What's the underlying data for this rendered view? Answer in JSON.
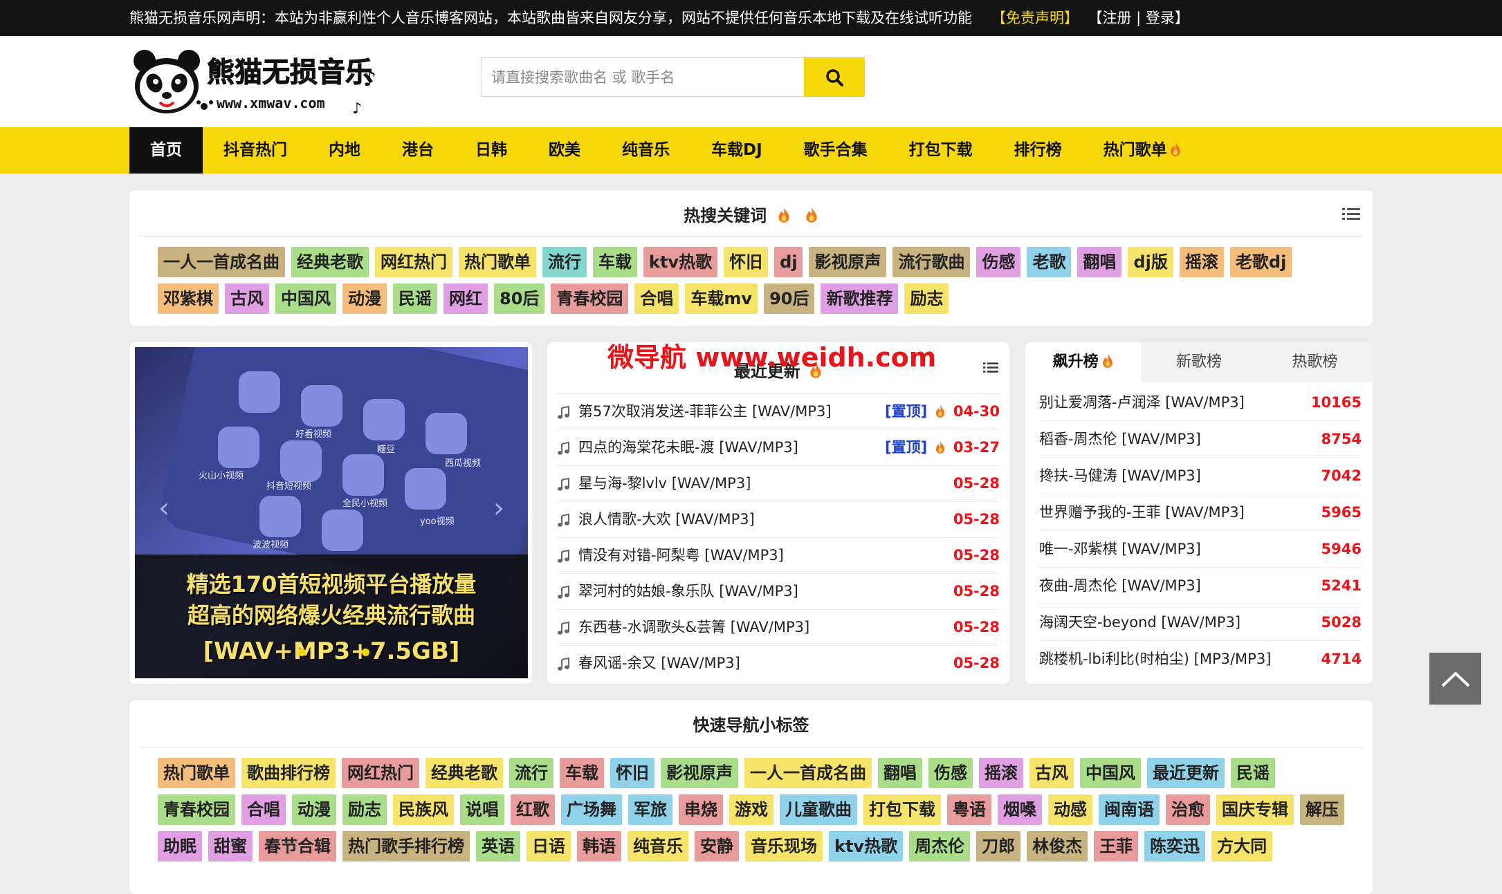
{
  "topbar": {
    "notice": "熊猫无损音乐网声明：本站为非赢利性个人音乐博客网站，本站歌曲皆来自网友分享，网站不提供任何音乐本地下载及在线试听功能",
    "disclaimer": "【免责声明】",
    "account": "【注册 | 登录】"
  },
  "logo": {
    "title": "熊猫无损音乐",
    "url": "www.xmwav.com"
  },
  "search": {
    "placeholder": "请直接搜索歌曲名 或 歌手名",
    "value": ""
  },
  "nav": [
    "首页",
    "抖音热门",
    "内地",
    "港台",
    "日韩",
    "欧美",
    "纯音乐",
    "车载DJ",
    "歌手合集",
    "打包下载",
    "排行榜",
    "热门歌单"
  ],
  "hot_keywords": {
    "title": "热搜关键词",
    "tags": [
      {
        "text": "一人一首成名曲",
        "color": "#c8b27f"
      },
      {
        "text": "经典老歌",
        "color": "#a9dd8a"
      },
      {
        "text": "网红热门",
        "color": "#f6e46a"
      },
      {
        "text": "热门歌单",
        "color": "#f6e46a"
      },
      {
        "text": "流行",
        "color": "#85d8cf"
      },
      {
        "text": "车载",
        "color": "#a9dd8a"
      },
      {
        "text": "ktv热歌",
        "color": "#e89b9b"
      },
      {
        "text": "怀旧",
        "color": "#f6e46a"
      },
      {
        "text": "dj",
        "color": "#e89b9b"
      },
      {
        "text": "影视原声",
        "color": "#c8b27f"
      },
      {
        "text": "流行歌曲",
        "color": "#c8b27f"
      },
      {
        "text": "伤感",
        "color": "#df9fe2"
      },
      {
        "text": "老歌",
        "color": "#8fd2ea"
      },
      {
        "text": "翻唱",
        "color": "#df9fe2"
      },
      {
        "text": "dj版",
        "color": "#f6e46a"
      },
      {
        "text": "摇滚",
        "color": "#f4bd7c"
      },
      {
        "text": "老歌dj",
        "color": "#f4bd7c"
      },
      {
        "text": "邓紫棋",
        "color": "#f4bd7c"
      },
      {
        "text": "古风",
        "color": "#df9fe2"
      },
      {
        "text": "中国风",
        "color": "#a9dd8a"
      },
      {
        "text": "动漫",
        "color": "#f4bd7c"
      },
      {
        "text": "民谣",
        "color": "#a9dd8a"
      },
      {
        "text": "网红",
        "color": "#df9fe2"
      },
      {
        "text": "80后",
        "color": "#a9dd8a"
      },
      {
        "text": "青春校园",
        "color": "#e89b9b"
      },
      {
        "text": "合唱",
        "color": "#f6e46a"
      },
      {
        "text": "车载mv",
        "color": "#f6e46a"
      },
      {
        "text": "90后",
        "color": "#c8b27f"
      },
      {
        "text": "新歌推荐",
        "color": "#df9fe2"
      },
      {
        "text": "励志",
        "color": "#f6e46a"
      }
    ]
  },
  "banner": {
    "caption1": "精选170首短视频平台播放量",
    "caption2": "超高的网络爆火经典流行歌曲",
    "caption3": "[WAV+MP3+7.5GB]",
    "app_labels": [
      "抖音短视频",
      "火山小视频",
      "好看视频",
      "全民小视频",
      "西瓜视频",
      "yoo视频",
      "糖豆",
      "波波视频"
    ]
  },
  "watermark": "微导航 www.weidh.com",
  "recent": {
    "title": "最近更新",
    "items": [
      {
        "song": "第57次取消发送-菲菲公主 [WAV/MP3]",
        "sticky": "[置顶]",
        "date": "04-30"
      },
      {
        "song": "四点的海棠花未眠-渡 [WAV/MP3]",
        "sticky": "[置顶]",
        "date": "03-27"
      },
      {
        "song": "星与海-黎lvlv [WAV/MP3]",
        "date": "05-28"
      },
      {
        "song": "浪人情歌-大欢 [WAV/MP3]",
        "date": "05-28"
      },
      {
        "song": "情没有对错-阿梨粤 [WAV/MP3]",
        "date": "05-28"
      },
      {
        "song": "翠河村的姑娘-象乐队 [WAV/MP3]",
        "date": "05-28"
      },
      {
        "song": "东西巷-水调歌头&芸箐 [WAV/MP3]",
        "date": "05-28"
      },
      {
        "song": "春风谣-余又 [WAV/MP3]",
        "date": "05-28"
      }
    ]
  },
  "charts": {
    "tabs": [
      "飙升榜",
      "新歌榜",
      "热歌榜"
    ],
    "items": [
      {
        "song": "别让爱凋落-卢润泽 [WAV/MP3]",
        "count": "10165"
      },
      {
        "song": "稻香-周杰伦 [WAV/MP3]",
        "count": "8754"
      },
      {
        "song": "搀扶-马健涛 [WAV/MP3]",
        "count": "7042"
      },
      {
        "song": "世界赠予我的-王菲 [WAV/MP3]",
        "count": "5965"
      },
      {
        "song": "唯一-邓紫棋 [WAV/MP3]",
        "count": "5946"
      },
      {
        "song": "夜曲-周杰伦 [WAV/MP3]",
        "count": "5241"
      },
      {
        "song": "海阔天空-beyond [WAV/MP3]",
        "count": "5028"
      },
      {
        "song": "跳楼机-lbi利比(时柏尘) [MP3/MP3]",
        "count": "4714"
      }
    ]
  },
  "quick_nav": {
    "title": "快速导航小标签",
    "tags": [
      {
        "text": "热门歌单",
        "color": "#f4bd7c"
      },
      {
        "text": "歌曲排行榜",
        "color": "#f6e46a"
      },
      {
        "text": "网红热门",
        "color": "#e89b9b"
      },
      {
        "text": "经典老歌",
        "color": "#f6e46a"
      },
      {
        "text": "流行",
        "color": "#a9dd8a"
      },
      {
        "text": "车载",
        "color": "#e89b9b"
      },
      {
        "text": "怀旧",
        "color": "#8fd2ea"
      },
      {
        "text": "影视原声",
        "color": "#a9dd8a"
      },
      {
        "text": "一人一首成名曲",
        "color": "#f6e46a"
      },
      {
        "text": "翻唱",
        "color": "#a9dd8a"
      },
      {
        "text": "伤感",
        "color": "#a9dd8a"
      },
      {
        "text": "摇滚",
        "color": "#df9fe2"
      },
      {
        "text": "古风",
        "color": "#f6e46a"
      },
      {
        "text": "中国风",
        "color": "#a9dd8a"
      },
      {
        "text": "最近更新",
        "color": "#8fd2ea"
      },
      {
        "text": "民谣",
        "color": "#a9dd8a"
      },
      {
        "text": "青春校园",
        "color": "#a9dd8a"
      },
      {
        "text": "合唱",
        "color": "#df9fe2"
      },
      {
        "text": "动漫",
        "color": "#a9dd8a"
      },
      {
        "text": "励志",
        "color": "#a9dd8a"
      },
      {
        "text": "民族风",
        "color": "#f6e46a"
      },
      {
        "text": "说唱",
        "color": "#a9dd8a"
      },
      {
        "text": "红歌",
        "color": "#e89b9b"
      },
      {
        "text": "广场舞",
        "color": "#8fd2ea"
      },
      {
        "text": "军旅",
        "color": "#8fd2ea"
      },
      {
        "text": "串烧",
        "color": "#e89b9b"
      },
      {
        "text": "游戏",
        "color": "#f6e46a"
      },
      {
        "text": "儿童歌曲",
        "color": "#8fd2ea"
      },
      {
        "text": "打包下载",
        "color": "#f6e46a"
      },
      {
        "text": "粤语",
        "color": "#e89b9b"
      },
      {
        "text": "烟嗓",
        "color": "#df9fe2"
      },
      {
        "text": "动感",
        "color": "#f6e46a"
      },
      {
        "text": "闽南语",
        "color": "#8fd2ea"
      },
      {
        "text": "治愈",
        "color": "#e89b9b"
      },
      {
        "text": "国庆专辑",
        "color": "#f6e46a"
      },
      {
        "text": "解压",
        "color": "#c8b27f"
      },
      {
        "text": "助眠",
        "color": "#df9fe2"
      },
      {
        "text": "甜蜜",
        "color": "#df9fe2"
      },
      {
        "text": "春节合辑",
        "color": "#e89b9b"
      },
      {
        "text": "热门歌手排行榜",
        "color": "#c8b27f"
      },
      {
        "text": "英语",
        "color": "#a9dd8a"
      },
      {
        "text": "日语",
        "color": "#f6e46a"
      },
      {
        "text": "韩语",
        "color": "#e89b9b"
      },
      {
        "text": "纯音乐",
        "color": "#f6e46a"
      },
      {
        "text": "安静",
        "color": "#e89b9b"
      },
      {
        "text": "音乐现场",
        "color": "#f6e46a"
      },
      {
        "text": "ktv热歌",
        "color": "#8fd2ea"
      },
      {
        "text": "周杰伦",
        "color": "#a9dd8a"
      },
      {
        "text": "刀郎",
        "color": "#c8b27f"
      },
      {
        "text": "林俊杰",
        "color": "#c8b27f"
      },
      {
        "text": "王菲",
        "color": "#e89b9b"
      },
      {
        "text": "陈奕迅",
        "color": "#8fd2ea"
      },
      {
        "text": "方大同",
        "color": "#f6e46a"
      }
    ]
  },
  "colors": {
    "accent": "#f5d70a",
    "hot": "#e8141a",
    "sticky": "#1a3fd1",
    "topbar": "#141414"
  }
}
